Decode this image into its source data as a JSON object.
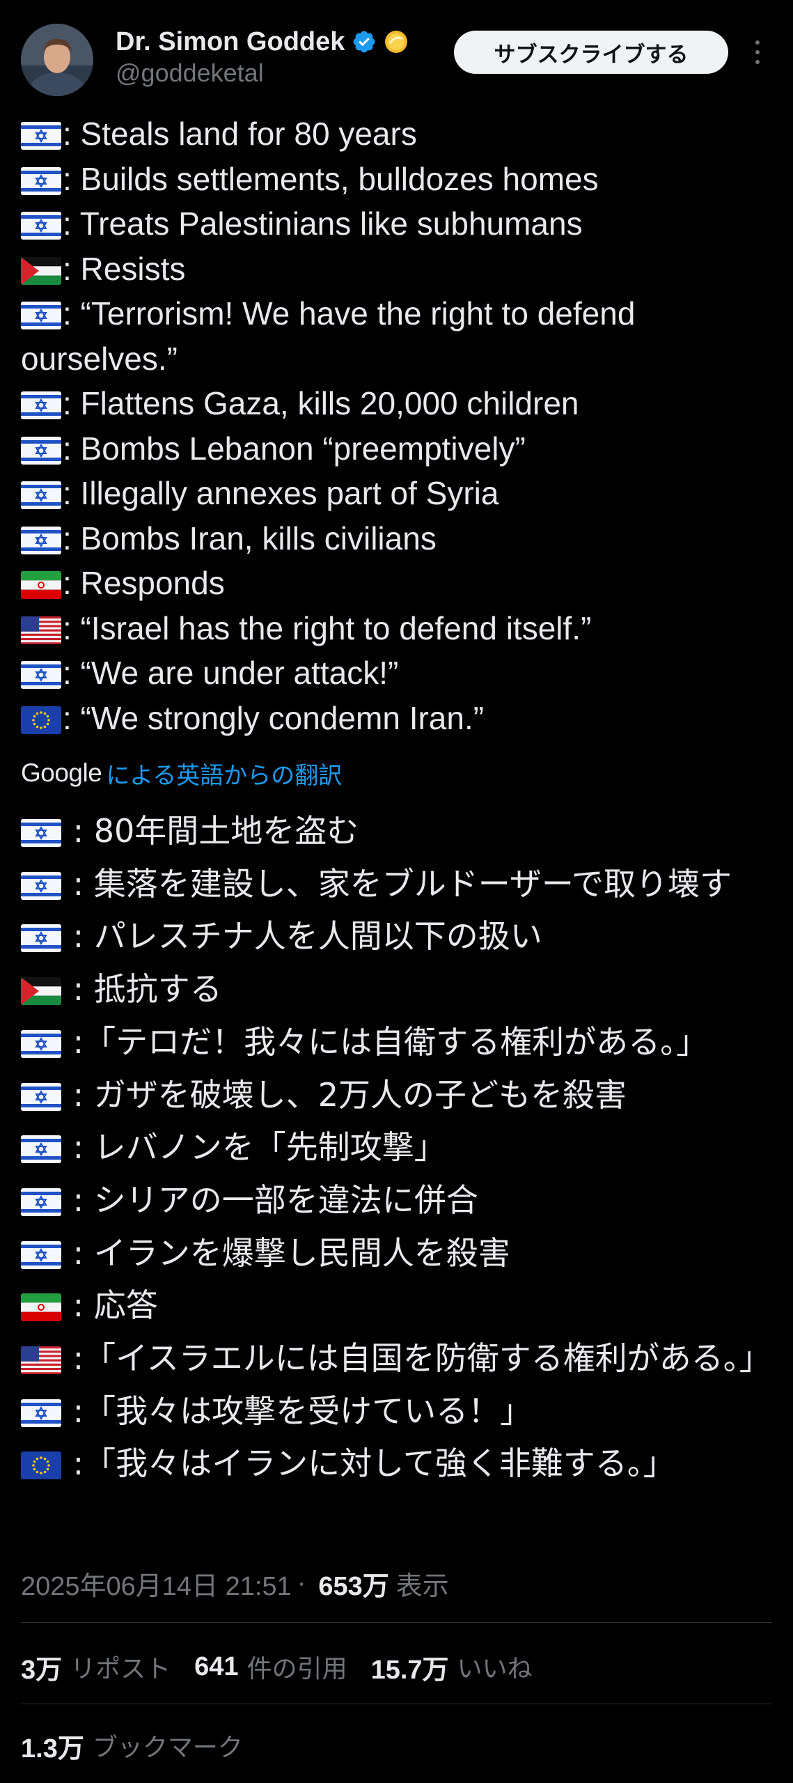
{
  "author": {
    "display_name": "Dr. Simon Goddek",
    "handle": "@goddeketal",
    "verified_badge_icon": "verified-badge-icon",
    "affiliate_badge_icon": "gold-coin-badge-icon"
  },
  "header": {
    "subscribe_label": "サブスクライブする",
    "more_icon": "more-vertical-icon"
  },
  "post": {
    "lines_en": [
      {
        "flag": "israel",
        "text": ": Steals land for 80 years"
      },
      {
        "flag": "israel",
        "text": ": Builds settlements, bulldozes homes"
      },
      {
        "flag": "israel",
        "text": ": Treats Palestinians like subhumans"
      },
      {
        "flag": "palestine",
        "text": ": Resists"
      },
      {
        "flag": "israel",
        "text": ": “Terrorism! We have the right to defend ourselves.”"
      },
      {
        "flag": "israel",
        "text": ": Flattens Gaza, kills 20,000 children"
      },
      {
        "flag": "israel",
        "text": ": Bombs Lebanon “preemptively”"
      },
      {
        "flag": "israel",
        "text": ": Illegally annexes part of Syria"
      },
      {
        "flag": "israel",
        "text": ": Bombs Iran, kills civilians"
      },
      {
        "flag": "iran",
        "text": ": Responds"
      },
      {
        "flag": "usa",
        "text": ": “Israel has the right to defend itself.”"
      },
      {
        "flag": "israel",
        "text": ": “We are under attack!”"
      },
      {
        "flag": "eu",
        "text": ": “We strongly condemn Iran.”"
      }
    ],
    "translation": {
      "provider": "Google",
      "label": "による英語からの翻訳"
    },
    "lines_ja": [
      {
        "flag": "israel",
        "text": " : 80年間土地を盗む"
      },
      {
        "flag": "israel",
        "text": " : 集落を建設し、家をブルドーザーで取り壊す"
      },
      {
        "flag": "israel",
        "text": " : パレスチナ人を人間以下の扱い"
      },
      {
        "flag": "palestine",
        "text": " : 抵抗する"
      },
      {
        "flag": "israel",
        "text": "  :「テロだ！我々には自衛する権利がある。」"
      },
      {
        "flag": "israel",
        "text": " : ガザを破壊し、2万人の子どもを殺害"
      },
      {
        "flag": "israel",
        "text": " : レバノンを「先制攻撃」"
      },
      {
        "flag": "israel",
        "text": " : シリアの一部を違法に併合"
      },
      {
        "flag": "israel",
        "text": " : イランを爆撃し民間人を殺害"
      },
      {
        "flag": "iran",
        "text": " : 応答"
      },
      {
        "flag": "usa",
        "text": "  :「イスラエルには自国を防衛する権利がある。」"
      },
      {
        "flag": "israel",
        "text": "  :「我々は攻撃を受けている！」"
      },
      {
        "flag": "eu",
        "text": "  :「我々はイランに対して強く非難する。」"
      }
    ]
  },
  "meta": {
    "timestamp": "2025年06月14日 21:51",
    "separator": "·",
    "views_count": "653万",
    "views_label": "表示"
  },
  "stats": {
    "reposts_count": "3万",
    "reposts_label": "リポスト",
    "quotes_count": "641",
    "quotes_label": "件の引用",
    "likes_count": "15.7万",
    "likes_label": "いいね",
    "bookmarks_count": "1.3万",
    "bookmarks_label": "ブックマーク"
  },
  "colors": {
    "background": "#000000",
    "text_primary": "#e7e9ea",
    "text_secondary": "#71767b",
    "link_blue": "#1d9bf0",
    "divider": "#2f3336",
    "button_bg": "#eff3f4"
  }
}
